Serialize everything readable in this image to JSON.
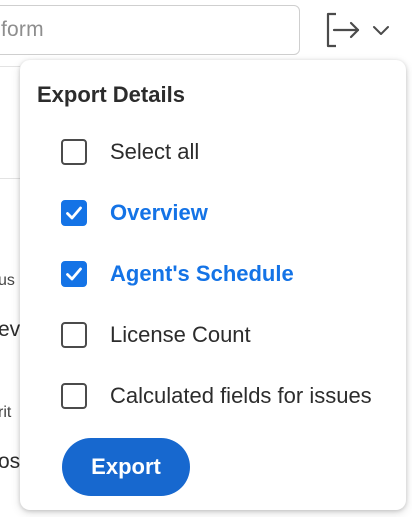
{
  "background": {
    "search_placeholder": "form",
    "fragments": [
      "us",
      "ev",
      "rit",
      "os"
    ]
  },
  "export_menu": {
    "trigger_icon": "export-arrow-icon",
    "chevron_icon": "chevron-down-icon",
    "title": "Export Details",
    "options": [
      {
        "label": "Select all",
        "checked": false
      },
      {
        "label": "Overview",
        "checked": true
      },
      {
        "label": "Agent's Schedule",
        "checked": true
      },
      {
        "label": "License Count",
        "checked": false
      },
      {
        "label": "Calculated fields for issues",
        "checked": false
      }
    ],
    "export_label": "Export",
    "accent_color": "#1473e6",
    "button_color": "#1768cf"
  }
}
